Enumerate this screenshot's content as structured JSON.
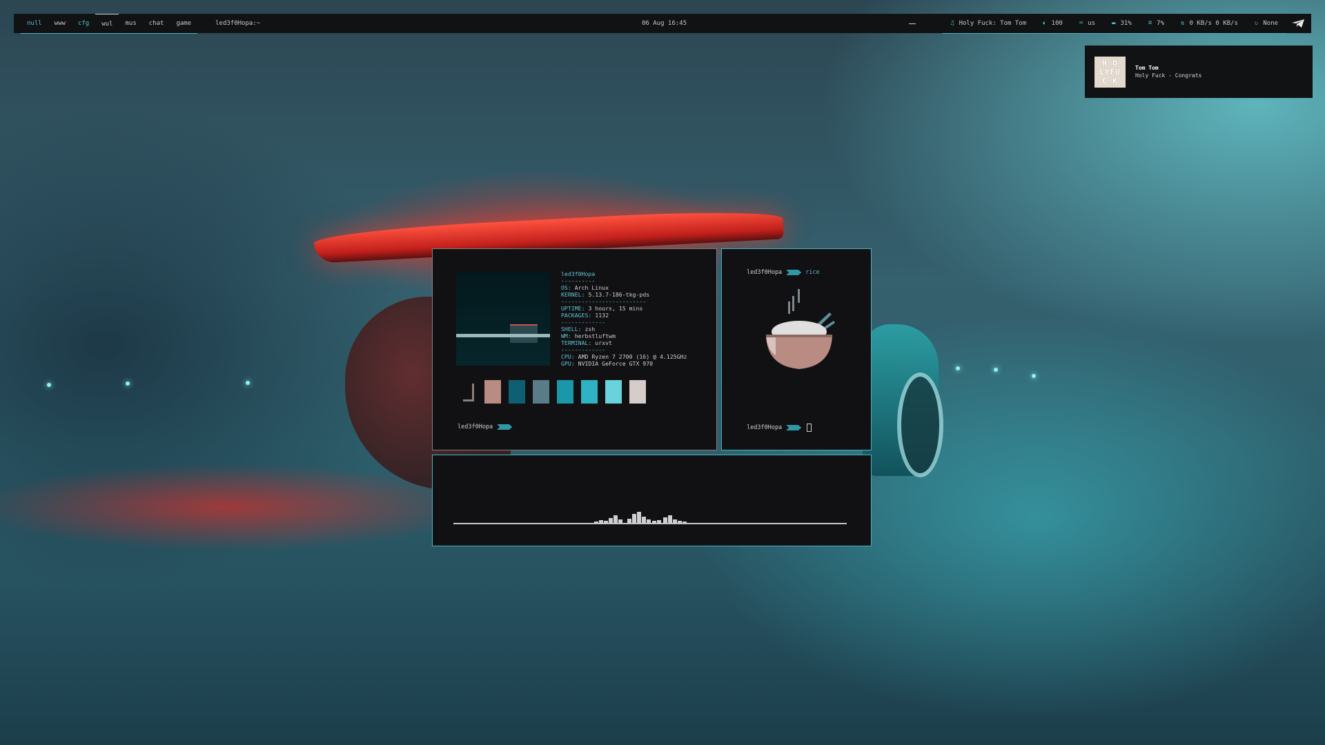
{
  "topbar": {
    "workspaces": [
      "null",
      "www",
      "cfg",
      "wul",
      "mus",
      "chat",
      "game"
    ],
    "window_title": "led3f0Hopa:~",
    "clock": "06 Aug 16:45",
    "music": "Holy Fuck: Tom Tom",
    "volume": "100",
    "keyboard_layout": "us",
    "memory": "31%",
    "cpu": "7%",
    "network": "0 KB/s 0 KB/s",
    "updates": "None"
  },
  "notification": {
    "art_text": "H O\nLYFU\nC K",
    "title": "Tom Tom",
    "body": "Holy Fuck - Congrats"
  },
  "fetch": {
    "user": "led3f0Hopa",
    "sep1": "----------",
    "os_k": "OS:",
    "os_v": " Arch Linux",
    "kernel_k": "KERNEL:",
    "kernel_v": " 5.13.7-186-tkg-pds",
    "sep2": "-------------------------",
    "uptime_k": "UPTIME:",
    "uptime_v": " 3 hours, 15 mins",
    "packages_k": "PACKAGES:",
    "packages_v": " 1132",
    "sep3": "-------------",
    "shell_k": "SHELL:",
    "shell_v": " zsh",
    "wm_k": "WM:",
    "wm_v": " herbstluftwm",
    "terminal_k": "TERMINAL:",
    "terminal_v": " urxvt",
    "sep4": "-------------",
    "cpu_k": "CPU:",
    "cpu_v": " AMD Ryzen 7 2700 (16) @ 4.125GHz",
    "gpu_k": "GPU:",
    "gpu_v": " NVIDIA GeForce GTX 970",
    "palette": [
      "#8a7f7a",
      "#b88c82",
      "#0f5f72",
      "#5a7c88",
      "#1a97a8",
      "#2fb3c2",
      "#6ad2da",
      "#d6ccca"
    ],
    "prompt_user": "led3f0Hopa"
  },
  "rice": {
    "prompt_user": "led3f0Hopa",
    "prompt_dir": "rice",
    "prompt_user_bottom": "led3f0Hopa"
  },
  "colors": {
    "accent": "#4db2c0",
    "bar_bg": "#111214",
    "terminal_bg": "#111114"
  }
}
